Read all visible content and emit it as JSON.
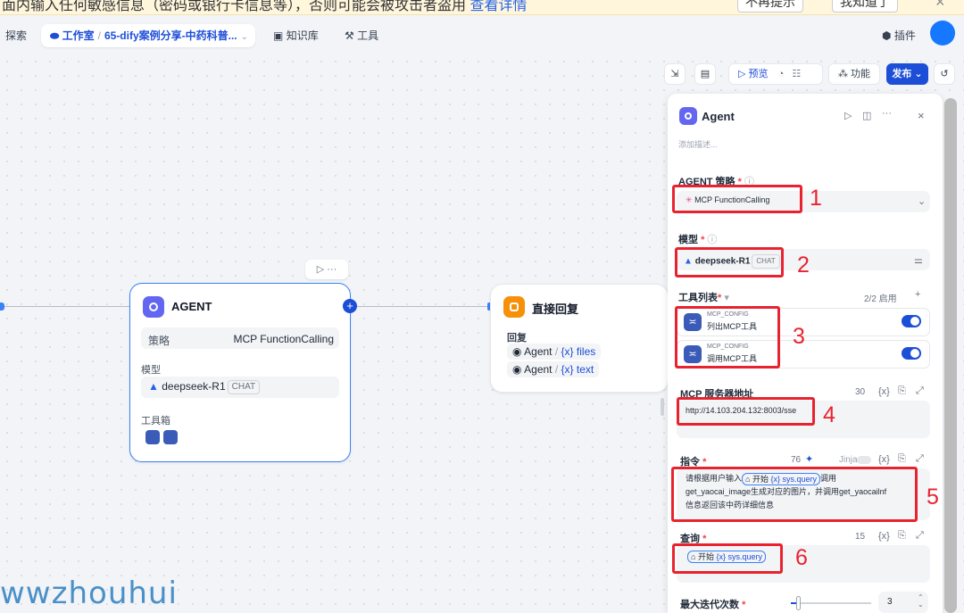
{
  "banner": {
    "text": "面内输入任何敏感信息（密码或银行卡信息等），否则可能会被攻击者盗用",
    "link": "查看详情",
    "btn1": "不再提示",
    "btn2": "我知道了",
    "close": "×"
  },
  "nav": {
    "explore": "探索",
    "studio": "工作室",
    "app_name": "65-dify案例分享-中药科普...",
    "knowledge": "知识库",
    "tools": "工具",
    "plugins": "插件"
  },
  "toolbar": {
    "preview": "预览",
    "features": "功能",
    "publish": "发布"
  },
  "agent_node": {
    "title": "AGENT",
    "strategy_label": "策略",
    "strategy_value": "MCP FunctionCalling",
    "model_label": "模型",
    "model_value": "deepseek-R1",
    "chat_badge": "CHAT",
    "toolbox_label": "工具箱"
  },
  "reply_node": {
    "title": "直接回复",
    "reply_label": "回复",
    "var1_node": "Agent",
    "var1_name": "{x} files",
    "var2_node": "Agent",
    "var2_name": "{x} text"
  },
  "panel": {
    "title": "Agent",
    "desc_placeholder": "添加描述...",
    "strategy_label": "AGENT 策略",
    "strategy_value": "MCP FunctionCalling",
    "model_label": "模型",
    "model_value": "deepseek-R1",
    "chat_badge": "CHAT",
    "tools_label": "工具列表",
    "tools_count": "2/2 启用",
    "tools": [
      {
        "provider": "MCP_CONFIG",
        "name": "列出MCP工具"
      },
      {
        "provider": "MCP_CONFIG",
        "name": "调用MCP工具"
      }
    ],
    "server_label": "MCP 服务器地址",
    "server_count": "30",
    "server_value": "http://14.103.204.132:8003/sse",
    "instruction_label": "指令",
    "instruction_count": "76",
    "jinja": "Jinja",
    "instruction_pre": "请根据用户输入",
    "instruction_chip_node": "开始",
    "instruction_chip_var": "{x} sys.query",
    "instruction_post": "调用",
    "instruction_line2": "get_yaocai_image生成对应的图片，并调用get_yaocailnf",
    "instruction_line3": "信息返回该中药详细信息",
    "query_label": "查询",
    "query_count": "15",
    "query_chip_node": "开始",
    "query_chip_var": "{x} sys.query",
    "max_iter_label": "最大迭代次数",
    "max_iter_value": "3"
  },
  "annotations": [
    "1",
    "2",
    "3",
    "4",
    "5",
    "6"
  ],
  "watermark": "wwzhouhui",
  "colors": {
    "accent": "#1d4ed8",
    "annotation": "#e8232f",
    "node_border": "#3b82f6",
    "reply_icon": "#f79009"
  }
}
